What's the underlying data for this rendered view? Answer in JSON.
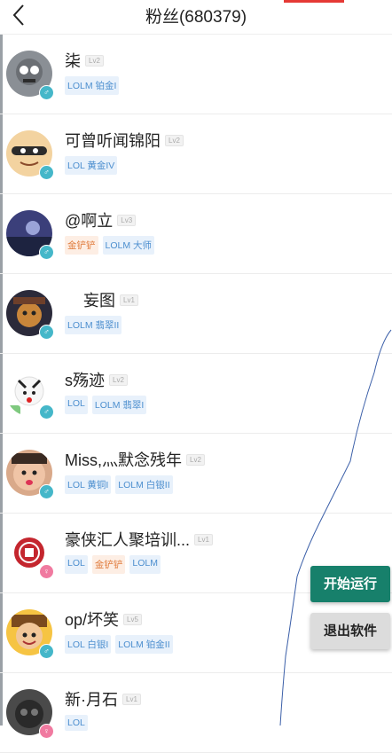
{
  "header": {
    "title": "粉丝(680379)"
  },
  "fans": [
    {
      "name": "柒",
      "level": "Lv2",
      "gender": "♂",
      "tags": [
        {
          "text": "LOLM 铂金I",
          "color": "blue"
        }
      ]
    },
    {
      "name": "可曾听闻锦阳",
      "level": "Lv2",
      "gender": "♂",
      "tags": [
        {
          "text": "LOL 黄金IV",
          "color": "blue"
        }
      ]
    },
    {
      "name": "@啊立",
      "level": "Lv3",
      "gender": "♂",
      "tags": [
        {
          "text": "金铲铲",
          "color": "orange"
        },
        {
          "text": "LOLM 大师",
          "color": "blue"
        }
      ]
    },
    {
      "name": "妄图",
      "level": "Lv1",
      "gender": "♂",
      "tags": [
        {
          "text": "LOLM 翡翠II",
          "color": "blue"
        }
      ]
    },
    {
      "name": "s殇迹",
      "level": "Lv2",
      "gender": "♂",
      "tags": [
        {
          "text": "LOL",
          "color": "blue"
        },
        {
          "text": "LOLM 翡翠I",
          "color": "blue"
        }
      ]
    },
    {
      "name": "Miss,灬默念残年",
      "level": "Lv2",
      "gender": "♂",
      "tags": [
        {
          "text": "LOL 黄铜I",
          "color": "blue"
        },
        {
          "text": "LOLM 白银II",
          "color": "blue"
        }
      ]
    },
    {
      "name": "豪侠汇人聚培训...",
      "level": "Lv1",
      "gender": "♀",
      "tags": [
        {
          "text": "LOL",
          "color": "blue"
        },
        {
          "text": "金铲铲",
          "color": "orange"
        },
        {
          "text": "LOLM",
          "color": "blue"
        }
      ]
    },
    {
      "name": "op/坏笑",
      "level": "Lv5",
      "gender": "♂",
      "tags": [
        {
          "text": "LOL 白银I",
          "color": "blue"
        },
        {
          "text": "LOLM 铂金II",
          "color": "blue"
        }
      ]
    },
    {
      "name": "新·月石",
      "level": "Lv1",
      "gender": "♀",
      "tags": [
        {
          "text": "LOL",
          "color": "blue"
        }
      ]
    }
  ],
  "buttons": {
    "start": "开始运行",
    "exit": "退出软件"
  },
  "colors": {
    "accent": "#17806b",
    "tag_blue": "#4d8fcf",
    "tag_orange": "#e07b3c",
    "male": "#45b7c9",
    "female": "#f07aa0"
  },
  "icons": {
    "back": "chevron-left-icon"
  }
}
